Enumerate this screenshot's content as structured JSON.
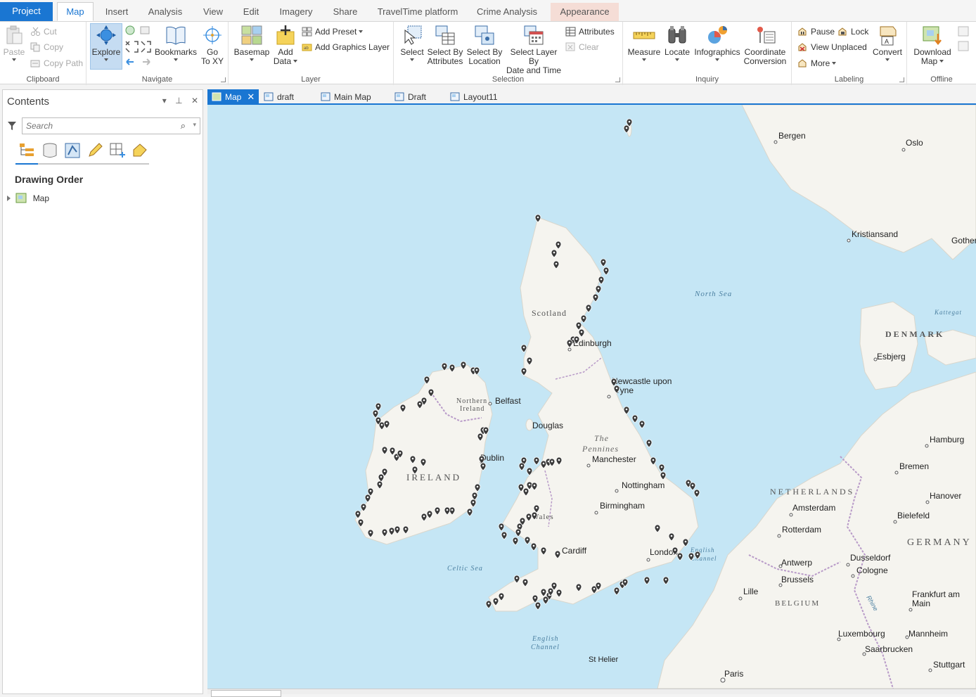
{
  "tabs": {
    "project": "Project",
    "map": "Map",
    "insert": "Insert",
    "analysis": "Analysis",
    "view": "View",
    "edit": "Edit",
    "imagery": "Imagery",
    "share": "Share",
    "traveltime": "TravelTime platform",
    "crime": "Crime Analysis",
    "appearance": "Appearance"
  },
  "ribbon": {
    "clipboard": {
      "label": "Clipboard",
      "paste": "Paste",
      "cut": "Cut",
      "copy": "Copy",
      "copy_path": "Copy Path"
    },
    "navigate": {
      "label": "Navigate",
      "explore": "Explore",
      "bookmarks": "Bookmarks",
      "go_to_xy_1": "Go",
      "go_to_xy_2": "To XY"
    },
    "layer": {
      "label": "Layer",
      "basemap": "Basemap",
      "add_data_1": "Add",
      "add_data_2": "Data",
      "add_preset": "Add Preset",
      "add_graphics_layer": "Add Graphics Layer"
    },
    "selection": {
      "label": "Selection",
      "select": "Select",
      "select_by_attr_1": "Select By",
      "select_by_attr_2": "Attributes",
      "select_by_loc_1": "Select By",
      "select_by_loc_2": "Location",
      "select_layer_1": "Select Layer By",
      "select_layer_2": "Date and Time",
      "attributes": "Attributes",
      "clear": "Clear"
    },
    "inquiry": {
      "label": "Inquiry",
      "measure": "Measure",
      "locate": "Locate",
      "infographics": "Infographics",
      "coord_1": "Coordinate",
      "coord_2": "Conversion"
    },
    "labeling": {
      "label": "Labeling",
      "pause": "Pause",
      "lock": "Lock",
      "view_unplaced": "View Unplaced",
      "more": "More",
      "convert": "Convert"
    },
    "offline": {
      "label": "Offline",
      "download_1": "Download",
      "download_2": "Map"
    }
  },
  "contents": {
    "title": "Contents",
    "search_placeholder": "Search",
    "drawing_order": "Drawing Order",
    "tree": [
      {
        "label": "Map"
      }
    ]
  },
  "view_tabs": [
    {
      "label": "Map",
      "active": true
    },
    {
      "label": "draft"
    },
    {
      "label": "Main Map"
    },
    {
      "label": "Draft"
    },
    {
      "label": "Layout11"
    }
  ],
  "map": {
    "countries": [
      "Scotland",
      "Northern",
      "Ireland",
      "IRELAND",
      "Wales",
      "DENMARK",
      "NETHERLANDS",
      "BELGIUM",
      "GERMANY"
    ],
    "water": [
      "North Sea",
      "Celtic Sea",
      "English",
      "Channel",
      "English Channel",
      "Kattegat",
      "The",
      "Pennines"
    ],
    "cities": [
      "Bergen",
      "Oslo",
      "Kristiansand",
      "Gother",
      "Edinburgh",
      "Newcastle upon",
      "Tyne",
      "Belfast",
      "Douglas",
      "Dublin",
      "Manchester",
      "Nottingham",
      "Birmingham",
      "Cardiff",
      "London",
      "Esbjerg",
      "Hamburg",
      "Bremen",
      "Hanover",
      "Amsterdam",
      "Rotterdam",
      "Bielefeld",
      "Antwerp",
      "Dusseldorf",
      "Cologne",
      "Brussels",
      "Lille",
      "Frankfurt am",
      "Main",
      "Luxembourg",
      "Mannheim",
      "Saarbrucken",
      "Stuttgart",
      "St Helier",
      "Paris",
      "Rhine"
    ],
    "marker_color": "#3a3a3a",
    "water_color": "#c5e6f5",
    "land_color": "#f5f4ef"
  }
}
